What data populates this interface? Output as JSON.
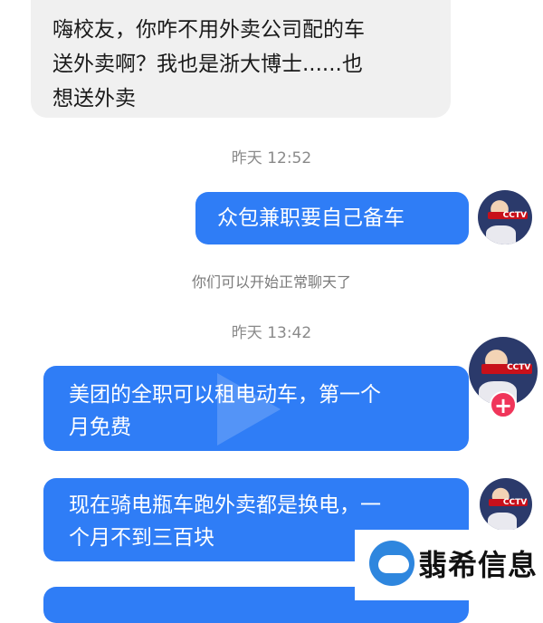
{
  "messages": {
    "incoming_1": {
      "line1": "嗨校友，你咋不用外卖公司配的车",
      "line2": "送外卖啊？我也是浙大博士......也",
      "line3": "想送外卖"
    },
    "timestamp_1": "昨天 12:52",
    "outgoing_1": "众包兼职要自己备车",
    "system_notice": "你们可以开始正常聊天了",
    "timestamp_2": "昨天 13:42",
    "outgoing_2": {
      "line1": "美团的全职可以租电动车，第一个",
      "line2": "月免费"
    },
    "outgoing_3": {
      "line1": "现在骑电瓶车跑外卖都是换电，一",
      "line2": "个月不到三百块"
    }
  },
  "avatar": {
    "badge_text": "CCTV",
    "add_symbol": "+"
  },
  "watermark": {
    "text": "翡希信息"
  },
  "colors": {
    "outgoing_bubble": "#2f7df6",
    "incoming_bubble": "#f0f0f0",
    "add_badge": "#f0355a",
    "watermark_logo": "#2e86de"
  }
}
